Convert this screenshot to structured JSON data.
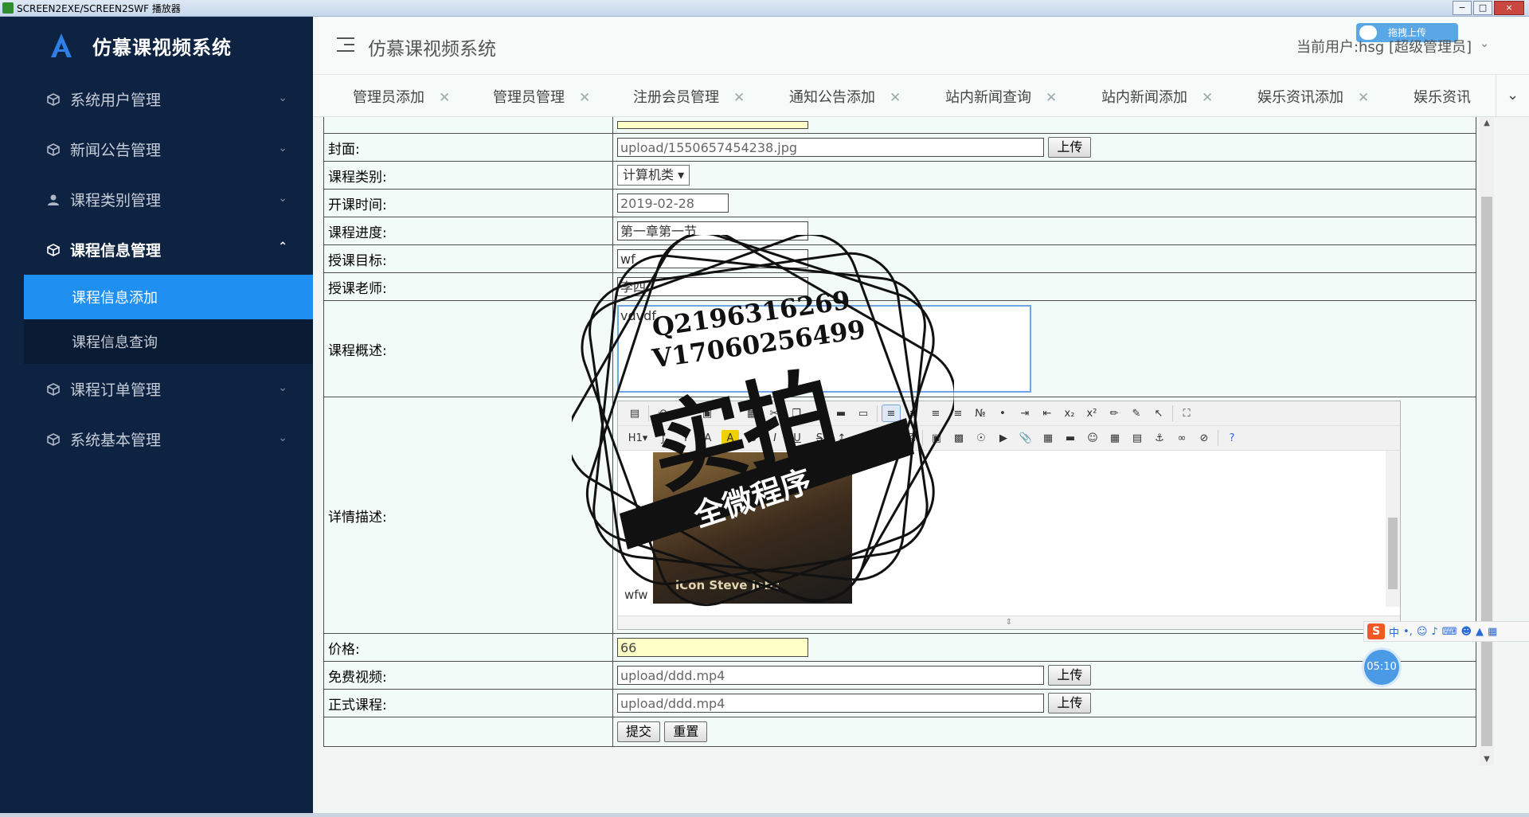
{
  "window": {
    "title": "SCREEN2EXE/SCREEN2SWF 播放器",
    "controls": [
      "−",
      "□",
      "×"
    ]
  },
  "sidebar": {
    "brand": "仿慕课视频系统",
    "items": [
      {
        "label": "系统用户管理",
        "icon": "cube-icon"
      },
      {
        "label": "新闻公告管理",
        "icon": "cube-icon"
      },
      {
        "label": "课程类别管理",
        "icon": "user-icon"
      },
      {
        "label": "课程信息管理",
        "icon": "cube-icon",
        "expanded": true
      },
      {
        "label": "课程订单管理",
        "icon": "cube-icon"
      },
      {
        "label": "系统基本管理",
        "icon": "cube-icon"
      }
    ],
    "sub_items": [
      {
        "label": "课程信息添加",
        "active": true
      },
      {
        "label": "课程信息查询",
        "active": false
      }
    ]
  },
  "header": {
    "app_name": "仿慕课视频系统",
    "user": "当前用户:hsg [超级管理员]",
    "upload_tag": "拖拽上传"
  },
  "tabs": [
    {
      "label": "管理员添加"
    },
    {
      "label": "管理员管理"
    },
    {
      "label": "注册会员管理"
    },
    {
      "label": "通知公告添加"
    },
    {
      "label": "站内新闻查询"
    },
    {
      "label": "站内新闻添加"
    },
    {
      "label": "娱乐资讯添加"
    },
    {
      "label": "娱乐资讯"
    }
  ],
  "form": {
    "cover": {
      "label": "封面:",
      "value": "upload/1550657454238.jpg",
      "upload_btn": "上传"
    },
    "category": {
      "label": "课程类别:",
      "value": "计算机类"
    },
    "start_time": {
      "label": "开课时间:",
      "value": "2019-02-28"
    },
    "progress": {
      "label": "课程进度:",
      "value": "第一章第一节"
    },
    "goal": {
      "label": "授课目标:",
      "value": "wf"
    },
    "teacher": {
      "label": "授课老师:",
      "value": "李四"
    },
    "summary": {
      "label": "课程概述:",
      "value": "vdvdf"
    },
    "detail": {
      "label": "详情描述:",
      "image_caption": "iCon Steve Jobs",
      "text": "wfw"
    },
    "price": {
      "label": "价格:",
      "value": "66"
    },
    "free_video": {
      "label": "免费视频:",
      "value": "upload/ddd.mp4",
      "upload_btn": "上传"
    },
    "formal_course": {
      "label": "正式课程:",
      "value": "upload/ddd.mp4",
      "upload_btn": "上传"
    },
    "submit": "提交",
    "reset": "重置"
  },
  "watermark": {
    "line1": "Q2196316269",
    "line2": "V17060256499",
    "big": "实拍",
    "ribbon": "全微程序"
  },
  "tray": {
    "ime": "中",
    "timer": "05:10"
  }
}
